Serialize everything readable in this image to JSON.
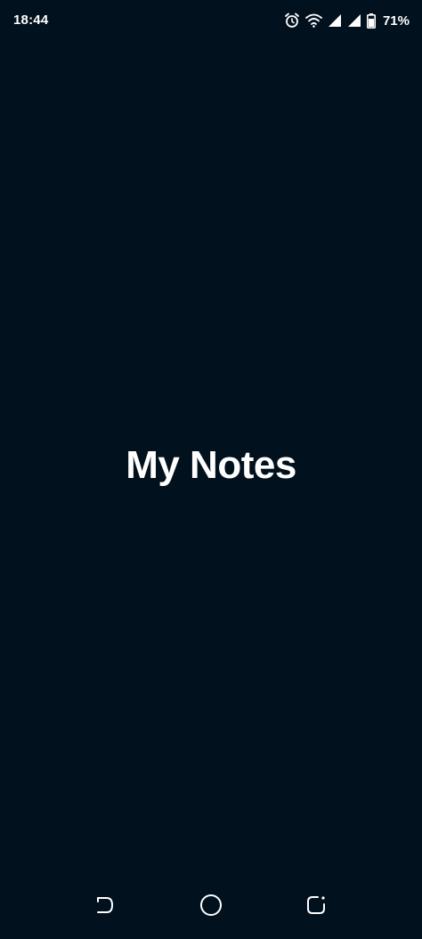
{
  "status_bar": {
    "time": "18:44",
    "battery_percent": "71%",
    "icons": [
      "alarm-icon",
      "wifi-icon",
      "signal-icon",
      "signal-icon",
      "battery-icon"
    ]
  },
  "splash": {
    "title": "My Notes"
  },
  "nav_bar": {
    "buttons": [
      "back",
      "home",
      "recents"
    ]
  },
  "colors": {
    "background": "#02111e",
    "foreground": "#ffffff"
  }
}
